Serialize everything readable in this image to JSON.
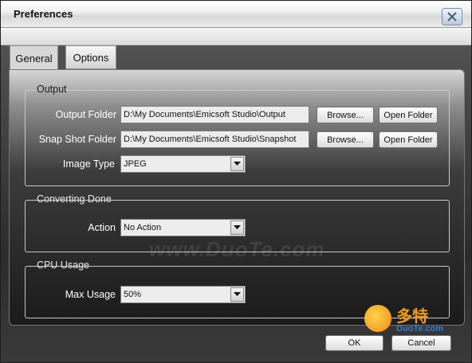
{
  "window": {
    "title": "Preferences"
  },
  "tabs": [
    {
      "label": "General",
      "active": true
    },
    {
      "label": "Options",
      "active": false
    }
  ],
  "output": {
    "legend": "Output",
    "output_folder_label": "Output Folder",
    "output_folder_value": "D:\\My Documents\\Emicsoft Studio\\Output",
    "snapshot_folder_label": "Snap Shot Folder",
    "snapshot_folder_value": "D:\\My Documents\\Emicsoft Studio\\Snapshot",
    "browse_label": "Browse...",
    "open_folder_label": "Open Folder",
    "image_type_label": "Image Type",
    "image_type_value": "JPEG"
  },
  "converting_done": {
    "legend": "Converting Done",
    "action_label": "Action",
    "action_value": "No Action"
  },
  "cpu_usage": {
    "legend": "CPU Usage",
    "max_usage_label": "Max Usage",
    "max_usage_value": "50%"
  },
  "footer": {
    "ok_label": "OK",
    "cancel_label": "Cancel"
  },
  "watermark": {
    "text": "www.DuoTe.com",
    "logo_cn": "多特",
    "logo_url": "DuoTe.com"
  },
  "colors": {
    "panel_dark": "#1b1b1b",
    "logo_orange": "#f29a1a",
    "logo_blue": "#2d7fd6"
  },
  "icons": {
    "close": "close-icon",
    "dropdown": "chevron-down-icon"
  }
}
